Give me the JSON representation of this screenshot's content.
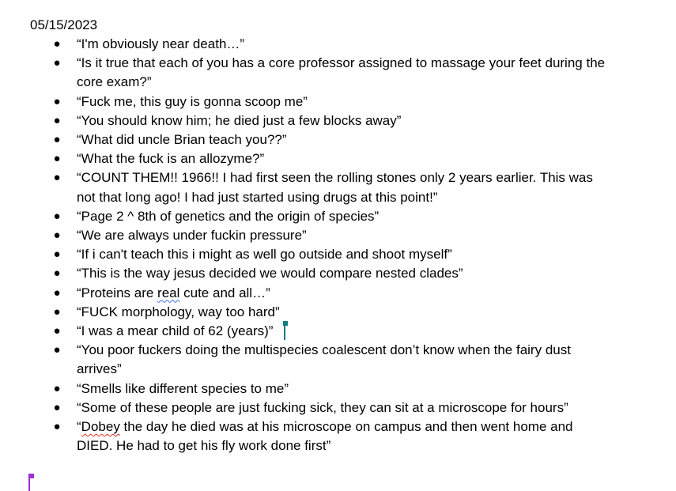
{
  "document": {
    "date": "05/15/2023",
    "colors": {
      "text": "#000000",
      "background": "#ffffff",
      "spell_blue": "#3b6fe0",
      "spell_red": "#d93025",
      "cursor_teal": "#0f7b84",
      "cursor_purple": "#9b30d9"
    },
    "items": [
      {
        "lines": [
          "“I'm obviously near death…”"
        ]
      },
      {
        "lines": [
          "“Is it true that each of you has a core professor assigned to massage your feet during the",
          "core exam?”"
        ]
      },
      {
        "lines": [
          "“Fuck me, this guy is gonna scoop me”"
        ]
      },
      {
        "lines": [
          "“You should know him; he died just a few blocks away”"
        ]
      },
      {
        "lines": [
          "“What did uncle Brian teach you??”"
        ]
      },
      {
        "lines": [
          "“What the fuck is an allozyme?”"
        ]
      },
      {
        "lines": [
          "“COUNT THEM!! 1966!! I had first seen the rolling stones only 2 years earlier. This was",
          "not that long ago! I had just started using drugs at this point!”"
        ]
      },
      {
        "lines": [
          "“Page 2 ^ 8th of genetics and the origin of species”"
        ]
      },
      {
        "lines": [
          "“We are always under fuckin pressure”"
        ]
      },
      {
        "lines": [
          "“If i can't teach this i might as well go outside and shoot myself”"
        ]
      },
      {
        "lines": [
          "“This is the way jesus decided we would compare nested clades”"
        ]
      },
      {
        "pre": "“Proteins are ",
        "flag": "real",
        "post": " cute and all…”"
      },
      {
        "lines": [
          "“FUCK morphology, way too hard”"
        ]
      },
      {
        "lines": [
          "“I was a mear child of 62 (years)”"
        ]
      },
      {
        "lines": [
          "“You poor fuckers doing the multispecies coalescent don’t know when the fairy dust",
          "arrives”"
        ]
      },
      {
        "lines": [
          "“Smells like different species to me”"
        ]
      },
      {
        "lines": [
          "“Some of these people are just fucking sick, they can sit at a microscope for hours”"
        ]
      },
      {
        "pre": "“",
        "flag": "Dobey",
        "post": " the day he died was at his microscope on campus and then went home and",
        "line2": "DIED. He had to get his fly work done first”"
      }
    ]
  }
}
